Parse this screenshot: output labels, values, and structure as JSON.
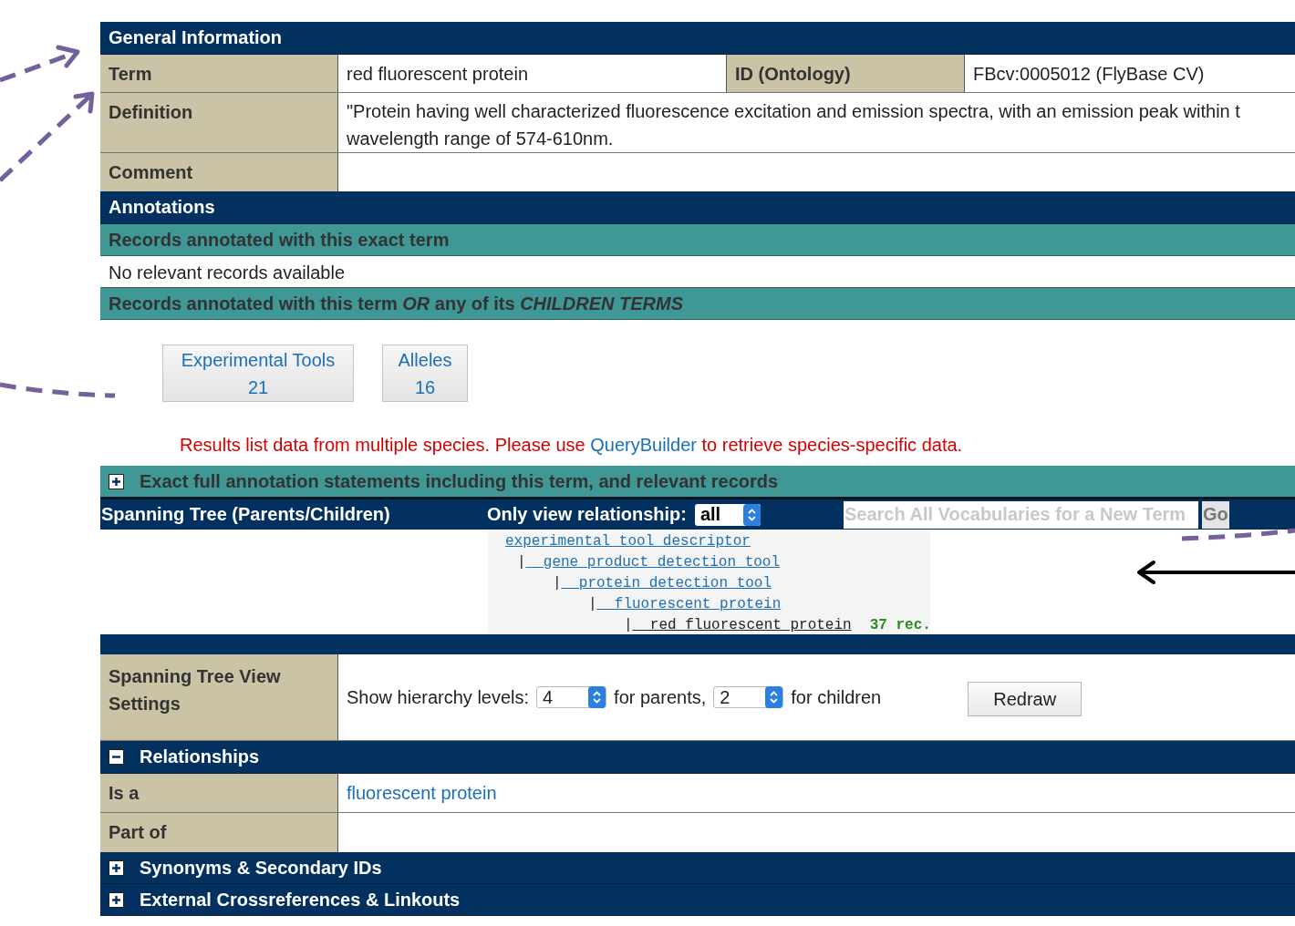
{
  "general_information": {
    "title": "General Information",
    "term_label": "Term",
    "term": "red fluorescent protein",
    "id_label": "ID (Ontology)",
    "id": "FBcv:0005012 (FlyBase CV)",
    "definition_label": "Definition",
    "definition_lines": [
      "\"Protein having well characterized fluorescence excitation and emission spectra, with an emission peak within t",
      "wavelength range of 574-610nm."
    ],
    "comment_label": "Comment"
  },
  "annotations": {
    "title": "Annotations",
    "exact_heading": "Records annotated with this exact term",
    "exact_message": "No relevant records available",
    "children_heading": "Records annotated with this term *OR* any of its *CHILDREN TERMS*"
  },
  "record_buttons": [
    {
      "label": "Experimental Tools",
      "count": "21"
    },
    {
      "label": "Alleles",
      "count": "16"
    }
  ],
  "species_notice": {
    "before": "Results list data from multiple species. Please use ",
    "link": "QueryBuilder",
    "after": " to retrieve species-specific data."
  },
  "exact_statements": {
    "title": "Exact full annotation statements including this term, and relevant records",
    "expanded": false
  },
  "spanning_tree": {
    "title": "Spanning Tree (Parents/Children)",
    "relationship_label": "Only view relationship:",
    "relationship_value": "all",
    "search_placeholder": "Search All Vocabularies for a New Term",
    "go_button": "Go",
    "tree": [
      {
        "label": "experimental tool descriptor",
        "current": false,
        "children": [
          {
            "branch": "|",
            "label": "__gene product detection tool",
            "current": false,
            "children": [
              {
                "branch": "|",
                "label": "__protein detection tool",
                "current": false,
                "children": [
                  {
                    "branch": "|",
                    "label": "__fluorescent protein",
                    "current": false,
                    "children": [
                      {
                        "branch": "|",
                        "label": "__red fluorescent protein",
                        "current": true,
                        "count": "37 rec."
                      }
                    ]
                  }
                ]
              }
            ]
          }
        ]
      }
    ]
  },
  "view_settings": {
    "label": "Spanning Tree View Settings",
    "levels_label": "Show hierarchy levels:",
    "parents_value": "4",
    "parents_label": "for parents,",
    "children_value": "2",
    "children_label": "for children",
    "redraw": "Redraw"
  },
  "relationships": {
    "title": "Relationships",
    "expanded": true,
    "rows": [
      {
        "label": "Is a",
        "value": "fluorescent protein"
      },
      {
        "label": "Part of"
      }
    ]
  },
  "collapsed_sections": [
    {
      "title": "Synonyms & Secondary IDs",
      "expanded": false
    },
    {
      "title": "External Crossreferences & Linkouts",
      "expanded": false
    }
  ]
}
